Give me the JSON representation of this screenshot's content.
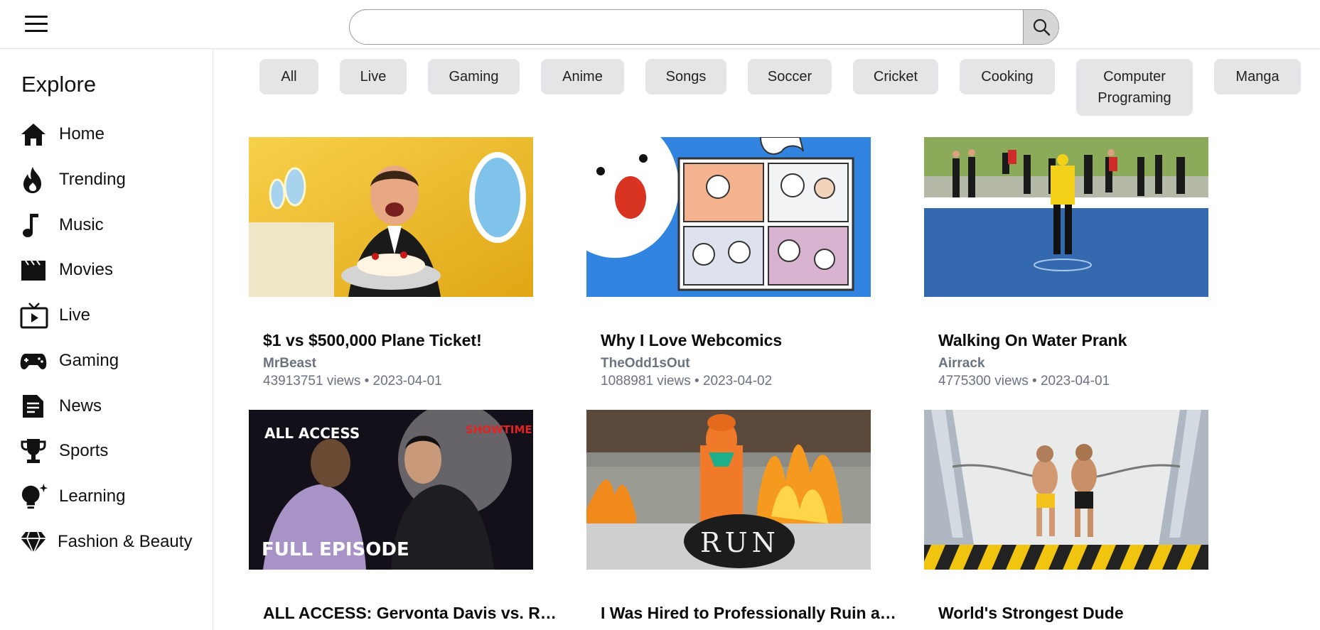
{
  "header": {
    "search": {
      "placeholder": "",
      "value": ""
    }
  },
  "sidebar": {
    "title": "Explore",
    "items": [
      {
        "label": "Home",
        "icon": "home-icon"
      },
      {
        "label": "Trending",
        "icon": "flame-icon"
      },
      {
        "label": "Music",
        "icon": "music-note-icon"
      },
      {
        "label": "Movies",
        "icon": "clapperboard-icon"
      },
      {
        "label": "Live",
        "icon": "live-tv-icon"
      },
      {
        "label": "Gaming",
        "icon": "gamepad-icon"
      },
      {
        "label": "News",
        "icon": "news-article-icon"
      },
      {
        "label": "Sports",
        "icon": "trophy-icon"
      },
      {
        "label": "Learning",
        "icon": "lightbulb-icon"
      },
      {
        "label": "Fashion & Beauty",
        "icon": "diamond-icon"
      }
    ]
  },
  "chips": [
    {
      "label": "All"
    },
    {
      "label": "Live"
    },
    {
      "label": "Gaming"
    },
    {
      "label": "Anime"
    },
    {
      "label": "Songs"
    },
    {
      "label": "Soccer"
    },
    {
      "label": "Cricket"
    },
    {
      "label": "Cooking"
    },
    {
      "label": "Computer Programing"
    },
    {
      "label": "Manga"
    }
  ],
  "videos": [
    {
      "title": "$1 vs $500,000 Plane Ticket!",
      "channel": "MrBeast",
      "meta": "43913751 views • 2023-04-01"
    },
    {
      "title": "Why I Love Webcomics",
      "channel": "TheOdd1sOut",
      "meta": "1088981 views • 2023-04-02"
    },
    {
      "title": "Walking On Water Prank",
      "channel": "Airrack",
      "meta": "4775300 views • 2023-04-01"
    },
    {
      "title": "ALL ACCESS: Gervonta Davis vs. Ryan ...",
      "thumb_text_1": "ALL ACCESS",
      "thumb_text_2": "SHOWTIME",
      "thumb_text_3": "FULL EPISODE"
    },
    {
      "title": "I Was Hired to Professionally Ruin a R...",
      "thumb_text_1": "RUN"
    },
    {
      "title": "World's Strongest Dude"
    }
  ],
  "colors": {
    "chip_bg": "#e5e5e7",
    "meta_gray": "#6b7280",
    "search_button_bg": "#d6d6d6"
  }
}
